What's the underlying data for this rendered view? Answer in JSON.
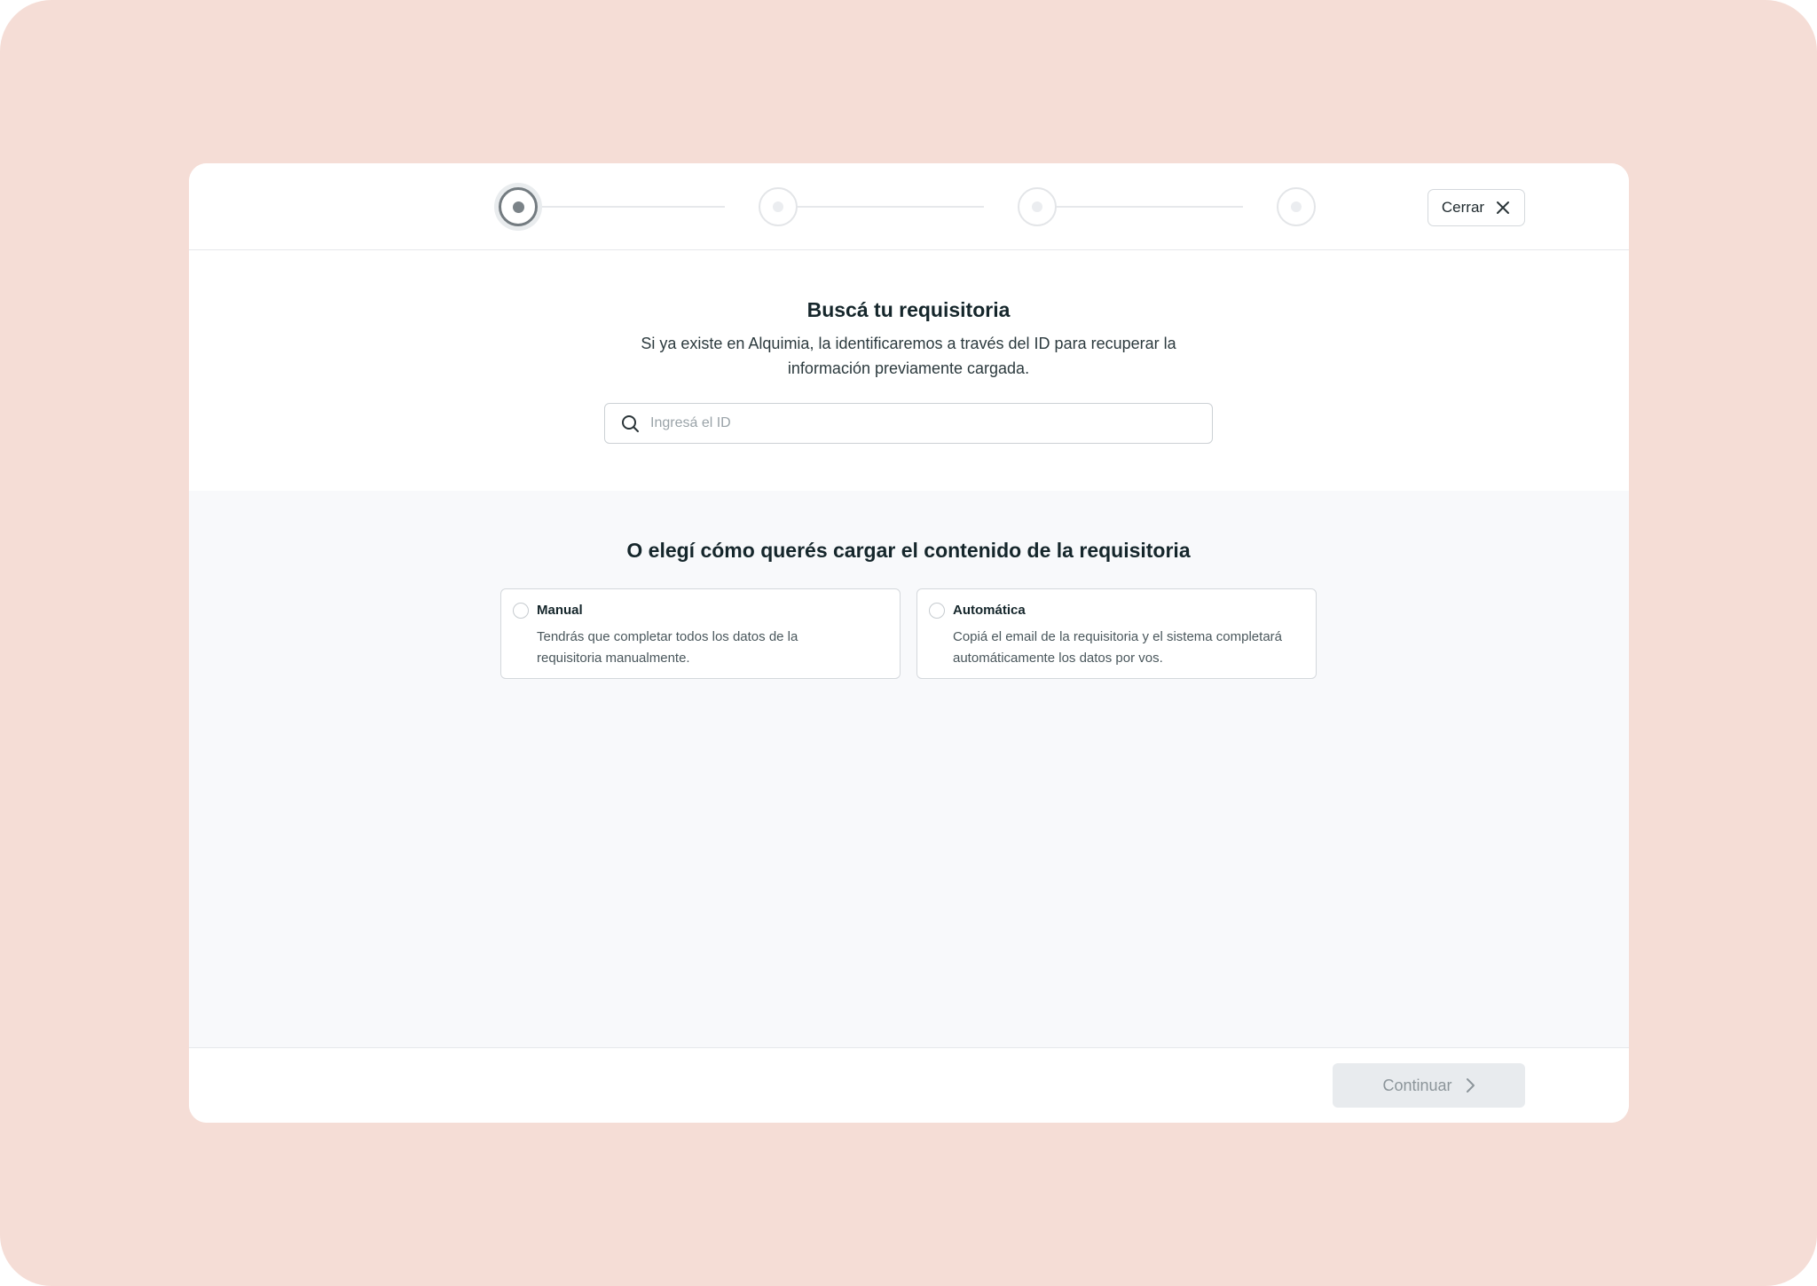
{
  "header": {
    "steps": [
      {
        "state": "active"
      },
      {
        "state": "pending"
      },
      {
        "state": "pending"
      },
      {
        "state": "pending"
      }
    ],
    "close_label": "Cerrar"
  },
  "search_section": {
    "title": "Buscá tu requisitoria",
    "subtitle_line1": "Si ya existe en Alquimia, la identificaremos a través del ID para recuperar la",
    "subtitle_line2": "información previamente cargada.",
    "search_placeholder": "Ingresá el ID",
    "search_value": ""
  },
  "load_section": {
    "title": "O elegí cómo querés cargar el contenido de la requisitoria",
    "options": [
      {
        "title": "Manual",
        "desc_line1": "Tendrás que completar todos los datos de la",
        "desc_line2": "requisitoria manualmente.",
        "selected": false
      },
      {
        "title": "Automática",
        "desc_line1": "Copiá el email de la requisitoria y el sistema completará",
        "desc_line2": "automáticamente los datos por vos.",
        "selected": false
      }
    ]
  },
  "footer": {
    "continue_label": "Continuar",
    "continue_disabled": true
  },
  "colors": {
    "backdrop": "#f5ddd6",
    "modal": "#ffffff",
    "section_bg": "#f8f9fb",
    "text_primary": "#15262b",
    "disabled_button": "#e8ebee"
  },
  "icons": {
    "search": "search-icon",
    "close": "close-icon",
    "chevron": "chevron-right-icon"
  }
}
